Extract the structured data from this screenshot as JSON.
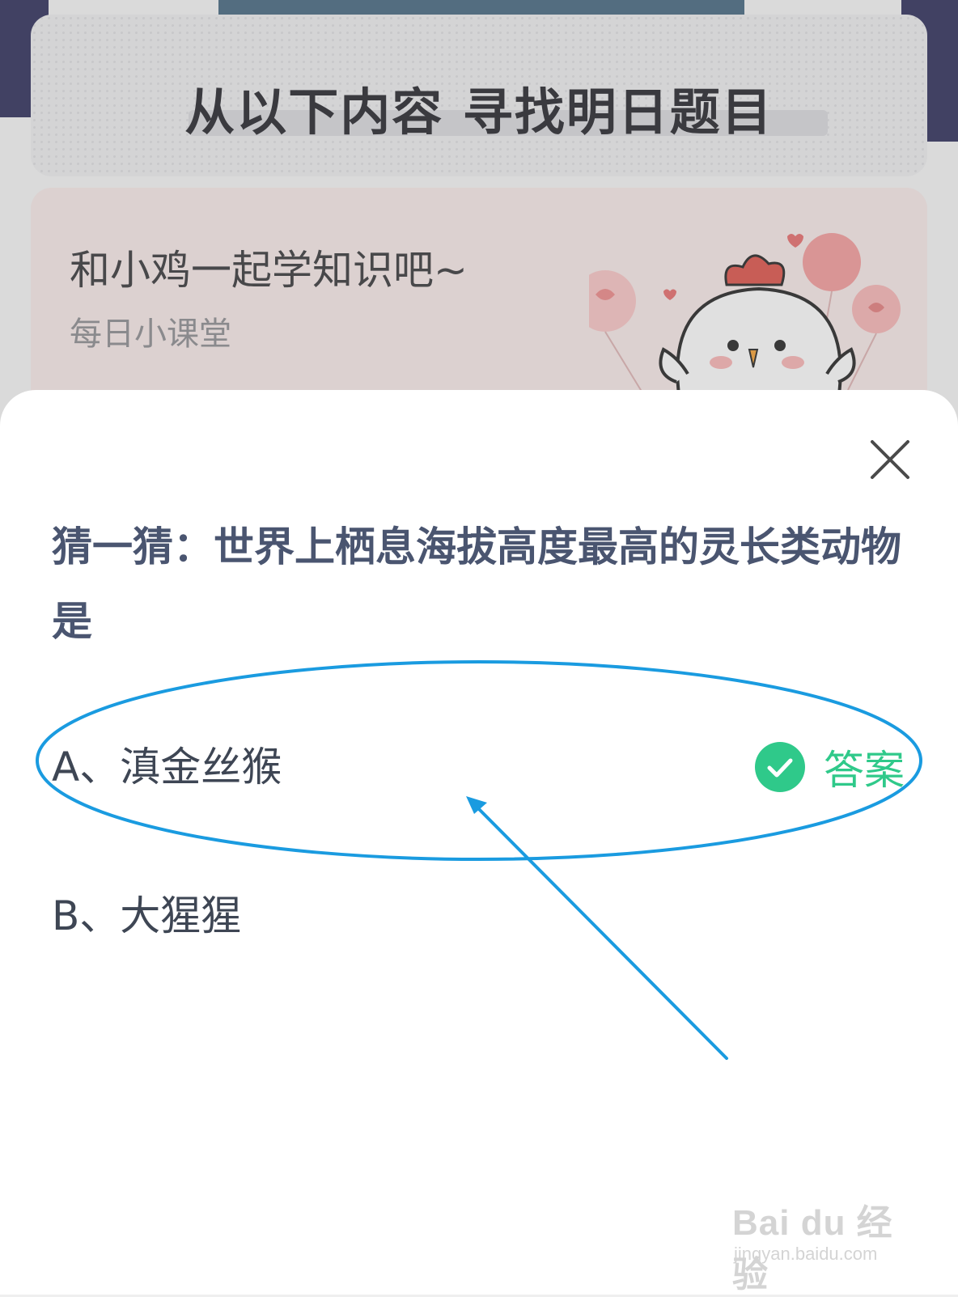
{
  "background": {
    "banner_title": "从以下内容  寻找明日题目",
    "lesson_card": {
      "title": "和小鸡一起学知识吧~",
      "subtitle": "每日小课堂"
    }
  },
  "modal": {
    "close_icon": "close-icon",
    "question": "猜一猜：世界上栖息海拔高度最高的灵长类动物是",
    "options": [
      {
        "label": "A、滇金丝猴",
        "is_answer": true,
        "answer_label": "答案"
      },
      {
        "label": "B、大猩猩",
        "is_answer": false
      }
    ]
  },
  "watermark": {
    "logo": "Bai du 经验",
    "url": "jingyan.baidu.com"
  },
  "colors": {
    "accent_green": "#2fc98a",
    "question_text": "#4a5570",
    "annotation_blue": "#1a9be0"
  }
}
